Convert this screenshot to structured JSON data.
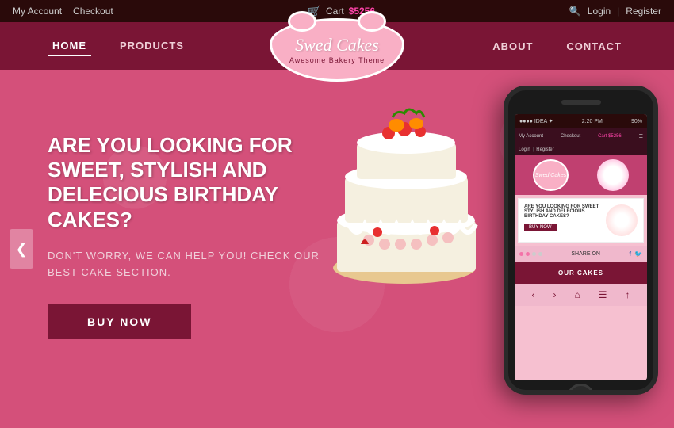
{
  "topbar": {
    "my_account": "My Account",
    "checkout": "Checkout",
    "cart_icon": "🛒",
    "cart_label": "Cart",
    "cart_amount": "$5256",
    "login": "Login",
    "register": "Register",
    "divider": "|"
  },
  "nav": {
    "home": "HOME",
    "products": "PRODUCTS",
    "about": "ABOUT",
    "contact": "CONTACT",
    "logo_text": "Swed Cakes",
    "logo_sub": "Awesome Bakery Theme"
  },
  "hero": {
    "title": "ARE YOU LOOKING FOR SWEET, STYLISH AND DELECIOUS BIRTHDAY CAKES?",
    "subtitle": "DON'T WORRY, WE CAN HELP YOU! CHECK OUR BEST CAKE SECTION.",
    "buy_now": "BUY NOW"
  },
  "phone": {
    "status_left": "●●●● IDEA ✦",
    "status_time": "2:20 PM",
    "status_battery": "90%",
    "nav_my_account": "My Account",
    "nav_checkout": "Checkout",
    "nav_cart": "Cart $5256",
    "nav_login": "Login",
    "nav_register": "Register",
    "mini_title": "ARE YOU LOOKING FOR SWEET, STYLISH AND DELECIOUS BIRTHDAY CAKES?",
    "buy_now": "BUY NOW",
    "share_label": "SHARE ON",
    "our_cakes": "OUR CAKES",
    "logo_text": "Swed Cakes"
  },
  "arrow_left": "❮"
}
